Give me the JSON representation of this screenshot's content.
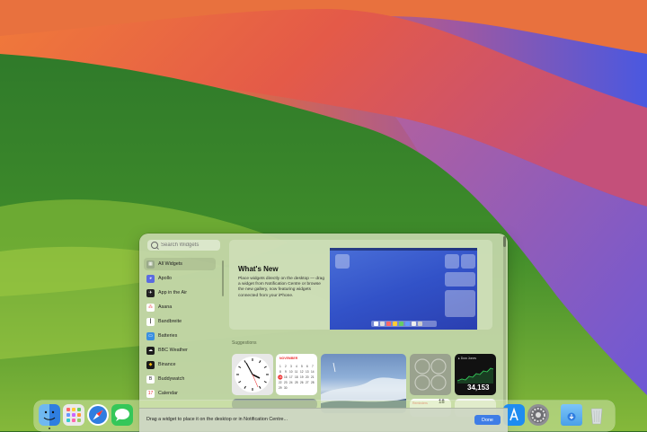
{
  "search": {
    "placeholder": "Search Widgets"
  },
  "sidebar": {
    "items": [
      {
        "label": "All Widgets",
        "icon": "widgets-icon",
        "color": "#8a9a7a"
      },
      {
        "label": "Apollo",
        "icon": "apollo-icon",
        "color": "#5b6be0"
      },
      {
        "label": "App in the Air",
        "icon": "app-in-the-air-icon",
        "color": "#222222"
      },
      {
        "label": "Asana",
        "icon": "asana-icon",
        "color": "#ffffff"
      },
      {
        "label": "Bandbreite",
        "icon": "bandbreite-icon",
        "color": "#ffffff"
      },
      {
        "label": "Batteries",
        "icon": "batteries-icon",
        "color": "#3a8f3a"
      },
      {
        "label": "BBC Weather",
        "icon": "bbc-weather-icon",
        "color": "#1d1d1d"
      },
      {
        "label": "Binance",
        "icon": "binance-icon",
        "color": "#1a1a1a"
      },
      {
        "label": "Buddywatch",
        "icon": "buddywatch-icon",
        "color": "#ffffff"
      },
      {
        "label": "Calendar",
        "icon": "calendar-icon",
        "color": "#ffffff"
      }
    ]
  },
  "whats_new": {
    "title": "What's New",
    "body": "Place widgets directly on the desktop — drag a widget from Notification Centre or browse the new gallery, now featuring widgets connected from your iPhone."
  },
  "suggestions": {
    "label": "Suggestions"
  },
  "widgets": {
    "calendar_month": "NOVEMBER",
    "calendar_highlight": "15",
    "stocks_name": "▸ Dow Jones",
    "stocks_value": "34,153",
    "reminders_label": "Reminders",
    "reminders_count": "18"
  },
  "placement_bar": {
    "text": "Drag a widget to place it on the desktop or in Notification Centre...",
    "done_label": "Done"
  },
  "dock": {
    "items": [
      {
        "name": "finder-icon",
        "color": "#3b8de8"
      },
      {
        "name": "launchpad-icon",
        "color": "#e8e8e8"
      },
      {
        "name": "safari-icon",
        "color": "#2f7de0"
      },
      {
        "name": "messages-icon",
        "color": "#35c759"
      },
      {
        "name": "app-store-icon",
        "color": "#1e8cf0"
      },
      {
        "name": "system-settings-icon",
        "color": "#8e8e93"
      },
      {
        "name": "downloads-folder-icon",
        "color": "#5ab0f0"
      },
      {
        "name": "trash-icon",
        "color": "#c8d0d0"
      }
    ]
  },
  "colors": {
    "accent": "#3f7de6",
    "panel": "#c4d6aa"
  }
}
